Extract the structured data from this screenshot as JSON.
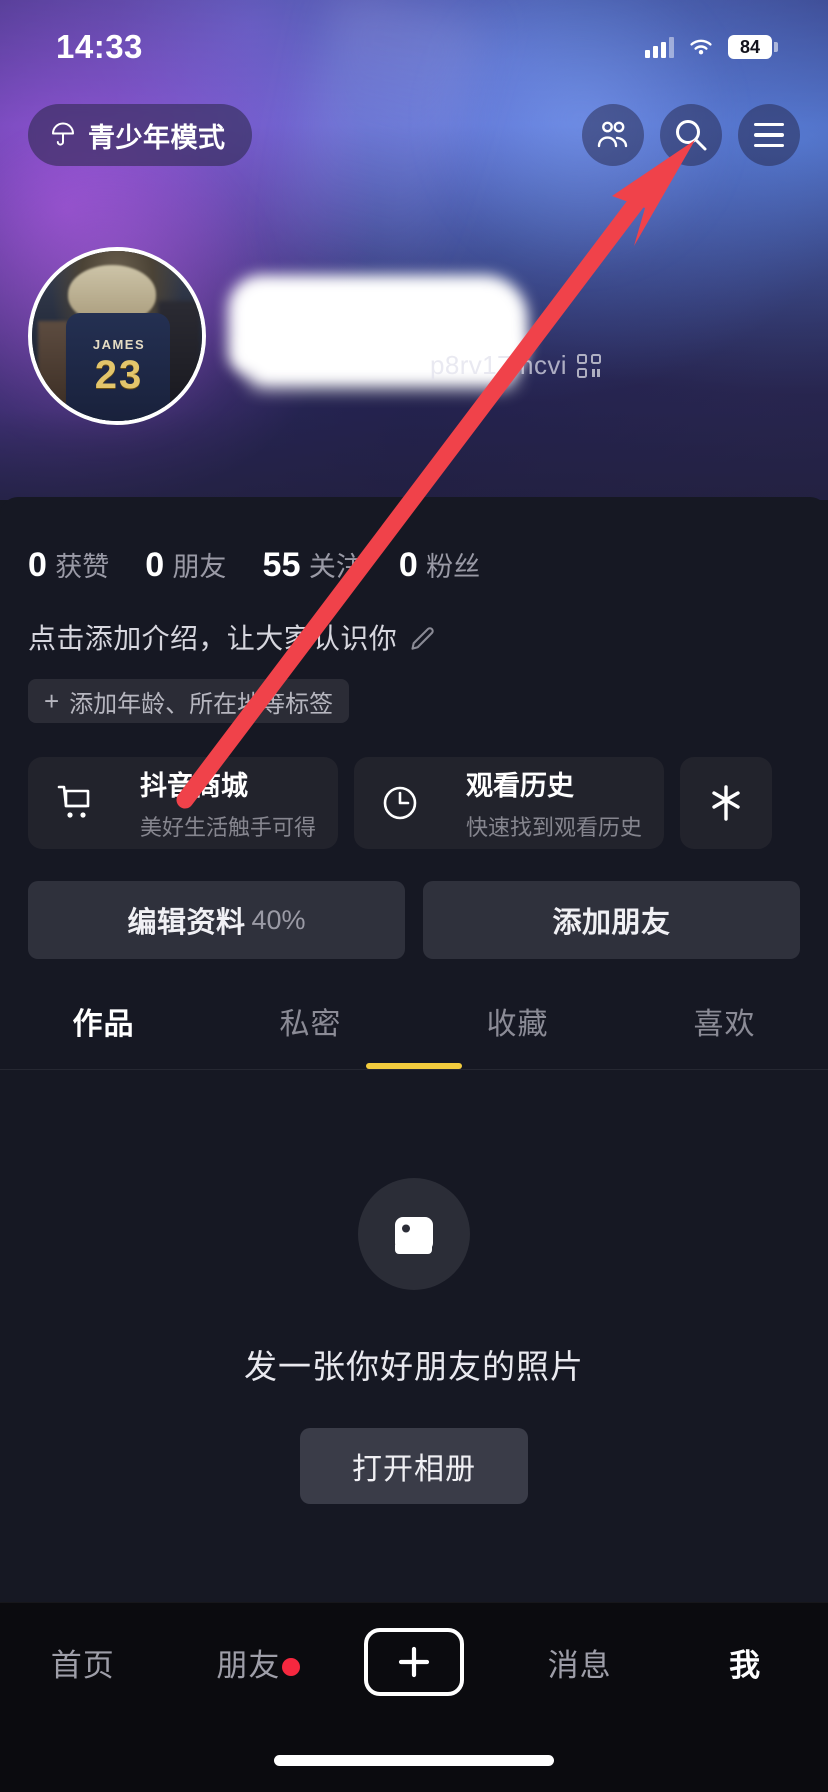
{
  "status_bar": {
    "time": "14:33",
    "battery_percent": "84",
    "signal_icon": "cellular-signal-icon",
    "wifi_icon": "wifi-icon",
    "battery_icon": "battery-icon"
  },
  "header": {
    "teen_mode_label": "青少年模式",
    "teen_mode_icon": "umbrella-icon",
    "friends_icon": "friends-icon",
    "search_icon": "search-icon",
    "menu_icon": "hamburger-menu-icon"
  },
  "profile": {
    "avatar_icon": "user-avatar",
    "avatar_jersey_name": "JAMES",
    "avatar_jersey_number": "23",
    "display_name": "",
    "douyin_id": "p8rv17mcvi",
    "qr_icon": "qr-code-icon"
  },
  "stats": [
    {
      "value": "0",
      "label": "获赞"
    },
    {
      "value": "0",
      "label": "朋友"
    },
    {
      "value": "55",
      "label": "关注"
    },
    {
      "value": "0",
      "label": "粉丝"
    }
  ],
  "bio": {
    "text": "点击添加介绍，让大家认识你",
    "edit_icon": "pencil-edit-icon",
    "tag_plus": "+",
    "tag_label": "添加年龄、所在地等标签"
  },
  "services": [
    {
      "title": "抖音商城",
      "subtitle": "美好生活触手可得",
      "icon": "shopping-cart-icon"
    },
    {
      "title": "观看历史",
      "subtitle": "快速找到观看历史",
      "icon": "clock-history-icon"
    }
  ],
  "service_more": {
    "icon": "douyin-star-icon"
  },
  "actions": {
    "edit_profile_label": "编辑资料",
    "edit_profile_percent": "40%",
    "add_friend_label": "添加朋友"
  },
  "tabs": [
    {
      "label": "作品",
      "active": true
    },
    {
      "label": "私密",
      "active": false
    },
    {
      "label": "收藏",
      "active": false
    },
    {
      "label": "喜欢",
      "active": false
    }
  ],
  "empty_state": {
    "icon": "photo-placeholder-icon",
    "text": "发一张你好朋友的照片",
    "button_label": "打开相册"
  },
  "bottom_nav": [
    {
      "label": "首页",
      "active": false,
      "badge": false
    },
    {
      "label": "朋友",
      "active": false,
      "badge": true
    },
    {
      "label": "",
      "active": false,
      "badge": false,
      "icon": "plus-create-icon"
    },
    {
      "label": "消息",
      "active": false,
      "badge": false
    },
    {
      "label": "我",
      "active": true,
      "badge": false
    }
  ],
  "annotation": {
    "type": "red-arrow",
    "color": "#f04040",
    "points_to": "hamburger-menu-icon"
  },
  "colors": {
    "accent_yellow": "#f3cc3e",
    "badge_red": "#f5283f",
    "sheet_bg": "#161823",
    "nav_bg": "#0b0b0f"
  }
}
